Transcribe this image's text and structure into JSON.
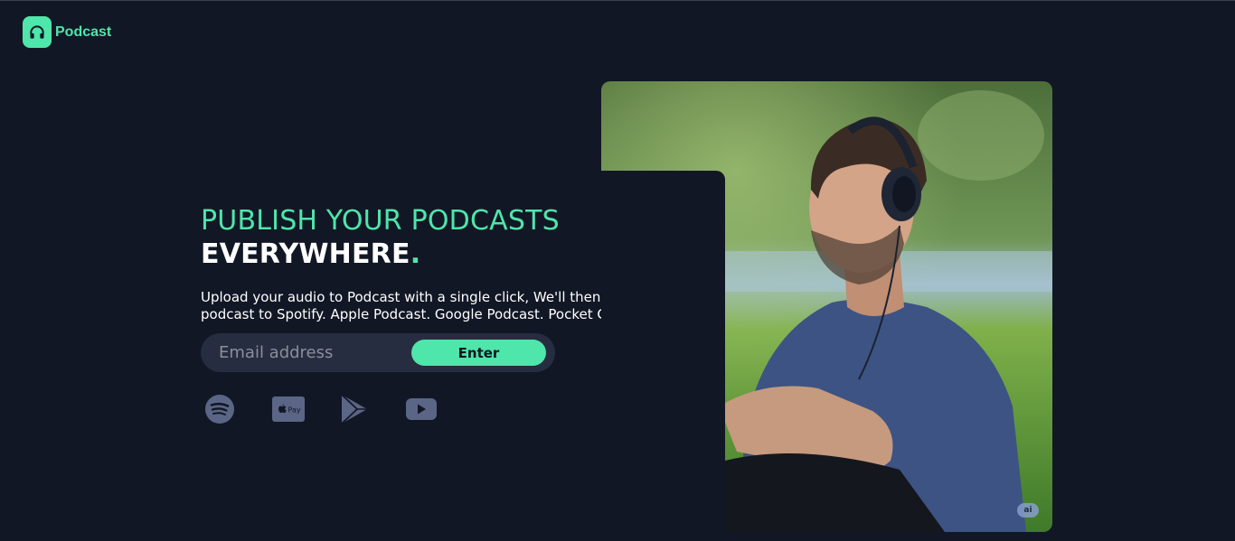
{
  "brand": {
    "name": "Podcast",
    "icon": "headphones-icon",
    "accent": "#4ee6aa"
  },
  "hero": {
    "headline_line1": "PUBLISH YOUR PODCASTS",
    "headline_line2": "EVERYWHERE",
    "headline_dot": ".",
    "description": "Upload your audio to Podcast with a single click, We'll then distribute your podcast to Spotify. Apple Podcast. Google Podcast. Pocket Casts and more!"
  },
  "signup": {
    "placeholder": "Email address",
    "button_label": "Enter"
  },
  "platforms": [
    {
      "icon": "spotify-icon"
    },
    {
      "icon": "apple-pay-icon",
      "label": "Pay"
    },
    {
      "icon": "google-play-icon"
    },
    {
      "icon": "youtube-icon"
    }
  ],
  "photo": {
    "badge": "ai"
  },
  "colors": {
    "background": "#121725",
    "accent": "#4ee6aa",
    "input_bg": "#272d41",
    "icon_muted": "#5b6586"
  }
}
